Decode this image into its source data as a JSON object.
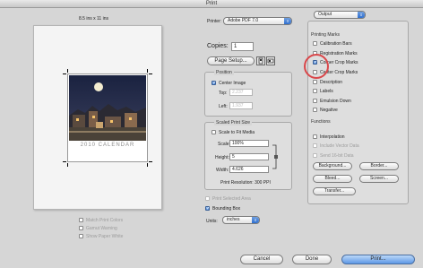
{
  "window": {
    "title": "Print"
  },
  "preview": {
    "size_label": "8.5 ins x 11 ins",
    "calendar_text": "2010 CALENDAR"
  },
  "printer": {
    "label": "Printer:",
    "value": "Adobe PDF 7.0"
  },
  "copies": {
    "label": "Copies:",
    "value": "1"
  },
  "page_setup": {
    "label": "Page Setup..."
  },
  "position": {
    "header": "Position",
    "center_image": "Center Image",
    "top_label": "Top:",
    "top_value": "2.237",
    "left_label": "Left:",
    "left_value": "1.937"
  },
  "scaled": {
    "header": "Scaled Print Size",
    "scale_to_fit": "Scale to Fit Media",
    "scale_label": "Scale:",
    "scale_value": "100%",
    "height_label": "Height:",
    "height_value": "5",
    "width_label": "Width:",
    "width_value": "4.626",
    "resolution": "Print Resolution: 300 PPI"
  },
  "print_selected_area": "Print Selected Area",
  "bounding_box": "Bounding Box",
  "units": {
    "label": "Units:",
    "value": "inches"
  },
  "left_options": [
    "Match Print Colors",
    "Gamut Warning",
    "Show Paper White"
  ],
  "output": {
    "popup": "Output",
    "printing_marks_header": "Printing Marks",
    "marks": [
      {
        "label": "Calibration Bars",
        "checked": false
      },
      {
        "label": "Registration Marks",
        "checked": false
      },
      {
        "label": "Corner Crop Marks",
        "checked": true
      },
      {
        "label": "Center Crop Marks",
        "checked": false
      },
      {
        "label": "Description",
        "checked": false
      },
      {
        "label": "Labels",
        "checked": false
      },
      {
        "label": "Emulsion Down",
        "checked": false
      },
      {
        "label": "Negative",
        "checked": false
      }
    ],
    "functions_header": "Functions",
    "functions": [
      {
        "label": "Interpolation",
        "enabled": true
      },
      {
        "label": "Include Vector Data",
        "enabled": false
      },
      {
        "label": "Send 16-bit Data",
        "enabled": false
      }
    ],
    "buttons": {
      "background": "Background...",
      "border": "Border...",
      "bleed": "Bleed...",
      "screen": "Screen...",
      "transfer": "Transfer..."
    }
  },
  "footer": {
    "cancel": "Cancel",
    "done": "Done",
    "print": "Print..."
  },
  "colors": {
    "accent": "#4a86d8",
    "highlight_ring": "#d9474a"
  }
}
